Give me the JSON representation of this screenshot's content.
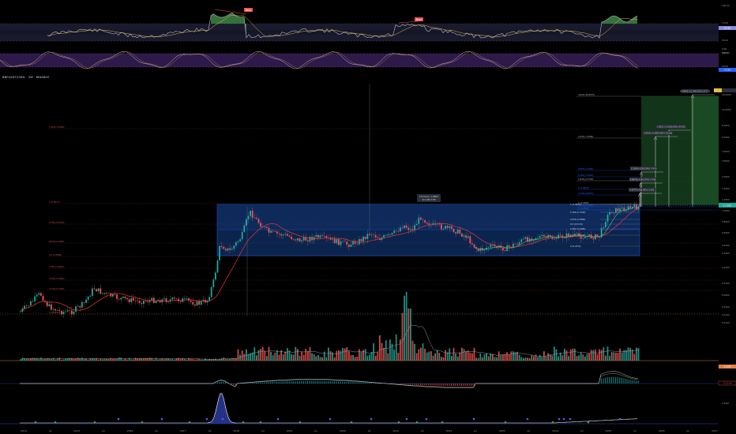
{
  "chart": {
    "symbol": "BNFUSDT/USDL · 2W · BINANCE",
    "background": "#000000",
    "up_color": "#26a69a",
    "down_color": "#ef5350",
    "accent": "#2962ff"
  },
  "time_axis": {
    "labels": [
      "2014",
      "Jul",
      "2015",
      "Jul",
      "2016",
      "Jul",
      "2017",
      "Jul",
      "2018",
      "Jul",
      "2019",
      "Jul",
      "2020",
      "Jul",
      "2021",
      "Jul",
      "2022",
      "Jul",
      "2023",
      "Jul",
      "2024",
      "Jul",
      "2025",
      "Jul",
      "2026",
      "Jul",
      "2027"
    ]
  },
  "price_axis": {
    "labels": [
      "16.0000",
      "12.0000",
      "8.0000",
      "6.0000",
      "4.0000",
      "3.0000",
      "2.0000",
      "1.6000",
      "1.2000",
      "1.0000",
      "0.8000",
      "0.6000",
      "0.4000",
      "0.3000",
      "0.2000",
      "0.1000",
      "0.0600",
      "0.0300",
      "0.0200",
      "0.0100"
    ],
    "current_price": "1.1700"
  },
  "oscillators": {
    "rsi": {
      "levels": [
        "100.00",
        "70.00",
        "50.00",
        "30.00",
        "0.00"
      ],
      "value": "61.66"
    },
    "stoch": {
      "levels": [
        "100.00",
        "80.00",
        "20.00",
        "0.00"
      ],
      "value": "71.84"
    },
    "macd": {
      "value": "-0.0149"
    },
    "volume": {
      "value": "2.05M"
    },
    "extra": {
      "value": "2.49M"
    }
  },
  "divergence_labels": [
    "Bear",
    "Bear"
  ],
  "range_box": {
    "tooltip_line1": "114 bars, 1,380d",
    "tooltip_line2": "Vol 180.71M"
  },
  "fib_levels": [
    {
      "label": "1 (0.9277)"
    },
    {
      "label": "0.786 (0.7445)"
    },
    {
      "label": "0.618 (0.5966)"
    },
    {
      "label": "0.5 (0.5170)"
    },
    {
      "label": "0.382 (0.4480)"
    },
    {
      "label": "0.236 (0.3600)"
    },
    {
      "label": "0 (0.2515)"
    }
  ],
  "fib_ext_left": [
    {
      "label": "1.618 (7.5596)"
    },
    {
      "label": "1 (0.9277)"
    },
    {
      "label": "0.786 (0.6130)"
    },
    {
      "label": "0.618 (0.4580)"
    },
    {
      "label": "0.5 (0.3680)"
    },
    {
      "label": "0.382 (0.2810)"
    },
    {
      "label": "0.236 (0.1950)"
    },
    {
      "label": "0.118 (0.0700)"
    },
    {
      "label": "0 (0.0500)"
    }
  ],
  "fib_ext_right": [
    {
      "label": "3.618 (16.8575)"
    },
    {
      "label": "2.618 (7.5596)"
    },
    {
      "label": "1.618 (4.7718)"
    },
    {
      "label": "1.618 (3.6070)"
    },
    {
      "label": "1.272 (3.1480)"
    },
    {
      "label": "1 (2.1660)"
    },
    {
      "label": "1 (1.8930)"
    },
    {
      "label": "0.786 (1.6120)"
    },
    {
      "label": "0.618 (1.3440)"
    },
    {
      "label": "1 (1.2310)"
    }
  ],
  "target_labels": [
    "16.9833 (+1,395.20%) 177,76",
    "5.0021 (+3,283.00%) 34,251",
    "3.3036 (+2,862.90%) 19,106",
    "2.1380 (+558.39%) 7,478",
    "0.9878 (+145.57%) 2,798",
    "0.6773 (+68.59%) 1,532"
  ],
  "chart_data": {
    "type": "candlestick",
    "x": [],
    "series": [],
    "xlabel": "",
    "ylabel": "",
    "ylim": [
      0.01,
      16
    ],
    "log_scale": true,
    "grid": false,
    "legend": "none"
  }
}
